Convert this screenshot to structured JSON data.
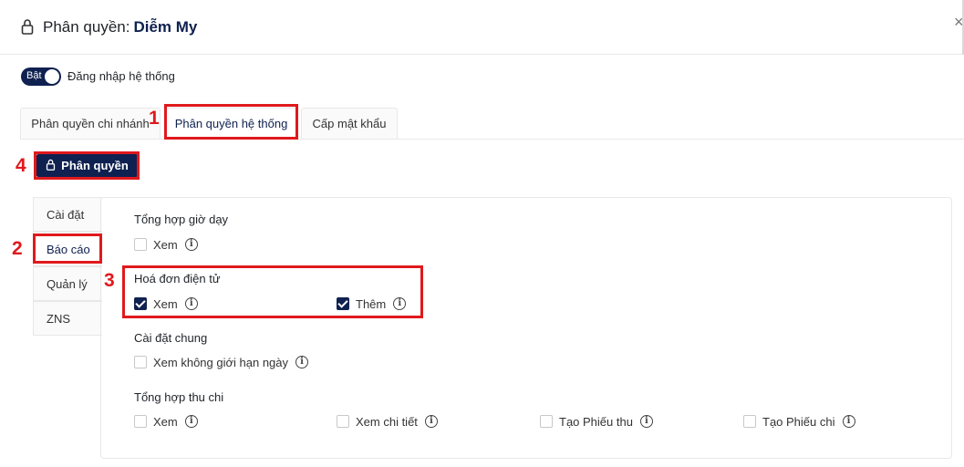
{
  "header": {
    "title_prefix": "Phân quyền:",
    "user_name": "Diễm My",
    "close_glyph": "×"
  },
  "toggle": {
    "state_label": "Bật",
    "label": "Đăng nhập hệ thống",
    "on": true
  },
  "tabs": [
    {
      "label": "Phân quyền chi nhánh",
      "active": false
    },
    {
      "label": "Phân quyền hệ thống",
      "active": true
    },
    {
      "label": "Cấp mật khẩu",
      "active": false
    }
  ],
  "permission_button": {
    "label": "Phân quyền",
    "icon": "lock-icon"
  },
  "sidebar": {
    "items": [
      {
        "label": "Cài đặt",
        "active": false
      },
      {
        "label": "Báo cáo",
        "active": true
      },
      {
        "label": "Quản lý",
        "active": false
      },
      {
        "label": "ZNS",
        "active": false
      }
    ]
  },
  "groups": [
    {
      "title": "Tổng hợp giờ dạy",
      "options": [
        {
          "label": "Xem",
          "checked": false
        }
      ]
    },
    {
      "title": "Hoá đơn điện tử",
      "options": [
        {
          "label": "Xem",
          "checked": true
        },
        {
          "label": "Thêm",
          "checked": true
        }
      ]
    },
    {
      "title": "Cài đặt chung",
      "options": [
        {
          "label": "Xem không giới hạn ngày",
          "checked": false
        }
      ]
    },
    {
      "title": "Tổng hợp thu chi",
      "options": [
        {
          "label": "Xem",
          "checked": false
        },
        {
          "label": "Xem chi tiết",
          "checked": false
        },
        {
          "label": "Tạo Phiếu thu",
          "checked": false
        },
        {
          "label": "Tạo Phiếu chi",
          "checked": false
        }
      ]
    }
  ],
  "annotations": {
    "n1": "1",
    "n2": "2",
    "n3": "3",
    "n4": "4",
    "color": "#e0191c"
  },
  "colors": {
    "primary": "#0f2150"
  }
}
